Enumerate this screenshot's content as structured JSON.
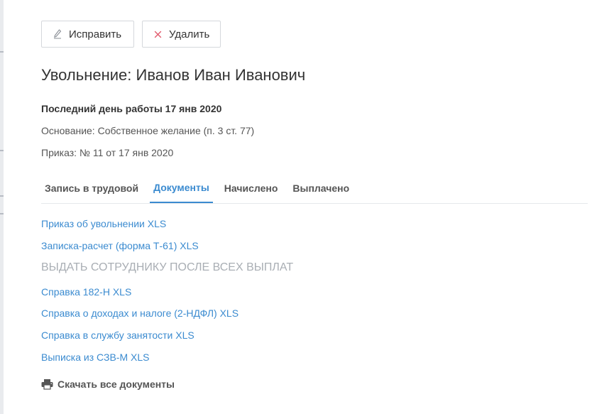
{
  "toolbar": {
    "edit_label": "Исправить",
    "delete_label": "Удалить",
    "edit_icon": "pencil-icon",
    "delete_icon": "close-icon",
    "delete_icon_color": "#e0576a"
  },
  "header": {
    "title": "Увольнение: Иванов Иван Иванович"
  },
  "details": {
    "last_day": "Последний день работы 17 янв 2020",
    "reason": "Основание: Собственное желание (п. 3 ст. 77)",
    "order": "Приказ: № 11 от 17 янв 2020"
  },
  "tabs": [
    {
      "label": "Запись в трудовой",
      "active": false
    },
    {
      "label": "Документы",
      "active": true
    },
    {
      "label": "Начислено",
      "active": false
    },
    {
      "label": "Выплачено",
      "active": false
    }
  ],
  "documents": {
    "primary": [
      {
        "label": "Приказ об увольнении XLS"
      },
      {
        "label": "Записка-расчет (форма Т-61) XLS"
      }
    ],
    "section_label": "ВЫДАТЬ СОТРУДНИКУ ПОСЛЕ ВСЕХ ВЫПЛАТ",
    "after_payout": [
      {
        "label": "Справка 182-Н XLS"
      },
      {
        "label": "Справка о доходах и налоге (2-НДФЛ) XLS"
      },
      {
        "label": "Справка в службу занятости XLS"
      },
      {
        "label": "Выписка из СЗВ-М XLS"
      }
    ]
  },
  "download": {
    "label": "Скачать все документы",
    "icon": "printer-icon"
  },
  "colors": {
    "accent": "#3b8bd0",
    "muted": "#a9aeb4"
  }
}
